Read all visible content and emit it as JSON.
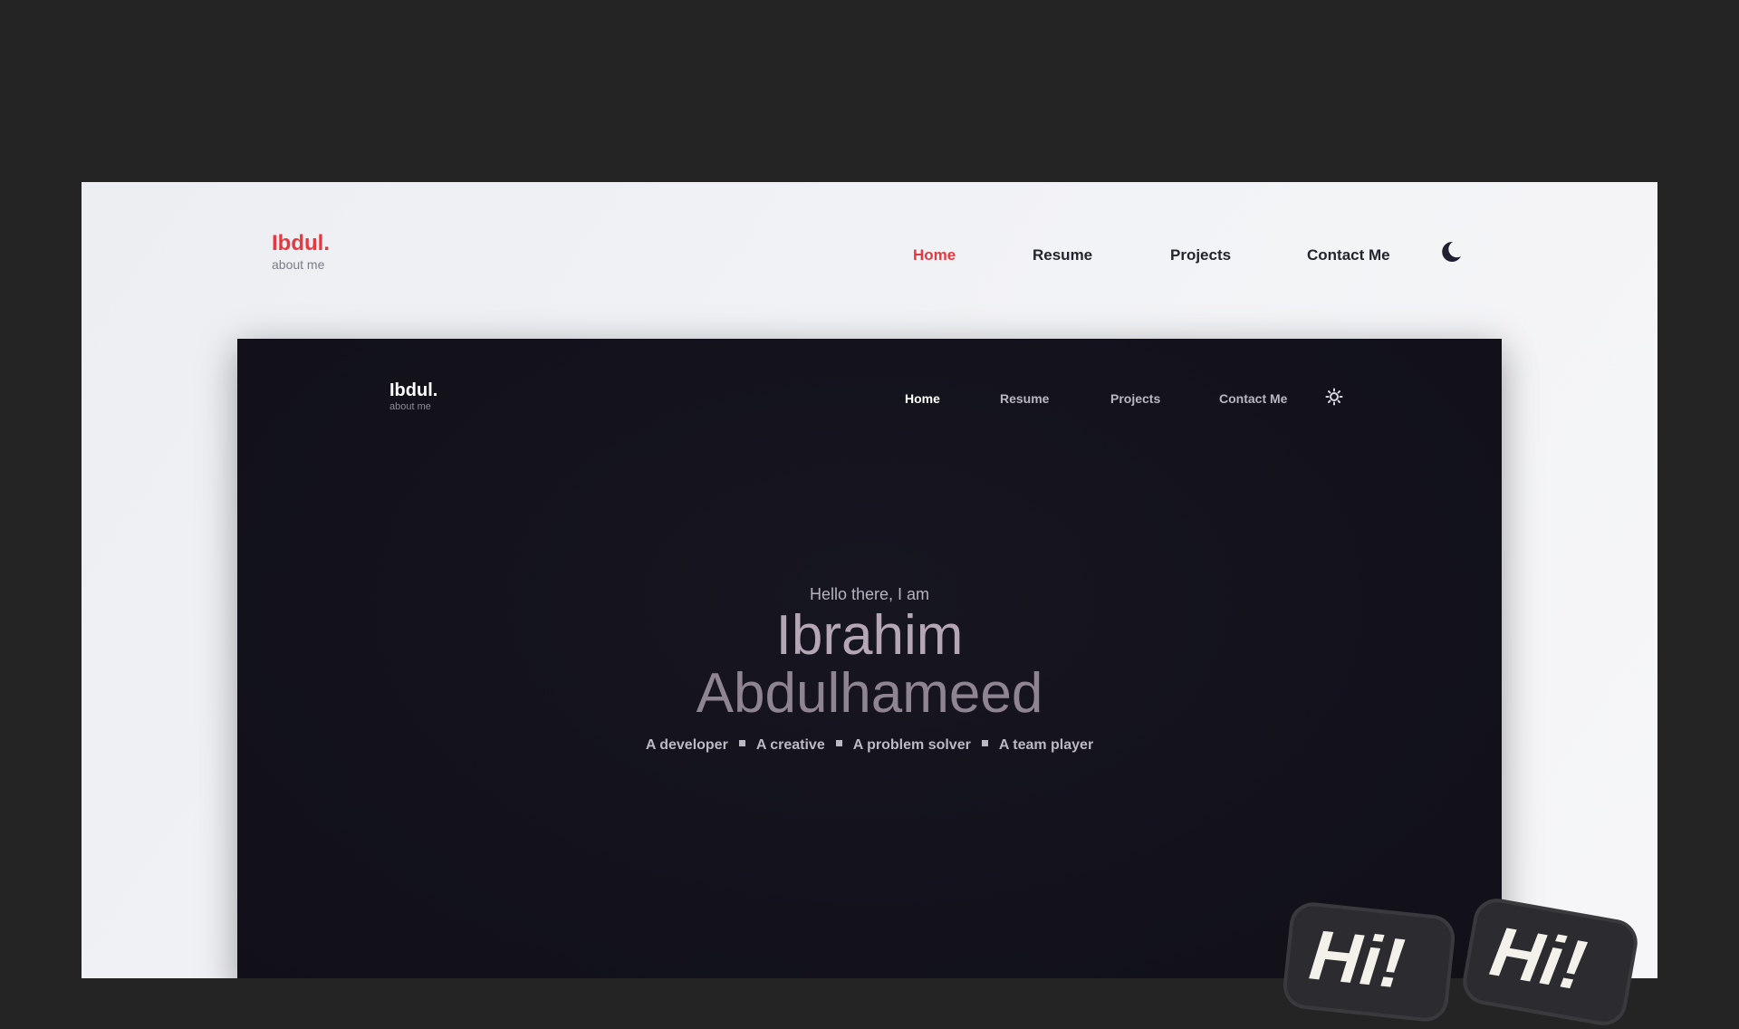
{
  "light": {
    "logo": {
      "name": "Ibdul.",
      "subtitle": "about me"
    },
    "nav": [
      {
        "label": "Home",
        "active": true
      },
      {
        "label": "Resume",
        "active": false
      },
      {
        "label": "Projects",
        "active": false
      },
      {
        "label": "Contact Me",
        "active": false
      }
    ],
    "theme_toggle_icon": "moon-icon",
    "accent": "#e5393f"
  },
  "dark": {
    "logo": {
      "name": "Ibdul.",
      "subtitle": "about me"
    },
    "nav": [
      {
        "label": "Home",
        "active": true
      },
      {
        "label": "Resume",
        "active": false
      },
      {
        "label": "Projects",
        "active": false
      },
      {
        "label": "Contact Me",
        "active": false
      }
    ],
    "theme_toggle_icon": "sun-icon",
    "hero": {
      "greeting": "Hello there, I am",
      "first_name": "Ibrahim",
      "last_name": "Abdulhameed",
      "tags": [
        "A developer",
        "A creative",
        "A problem solver",
        "A team player"
      ]
    }
  },
  "stickers": [
    {
      "text": "Hi!",
      "icon": "hi-sticker"
    },
    {
      "text": "Hi!",
      "icon": "hi-sticker"
    }
  ]
}
